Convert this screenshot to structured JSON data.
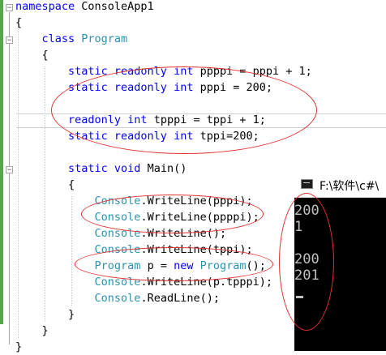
{
  "code": {
    "lines": [
      {
        "id": "l1",
        "parts": [
          {
            "t": "namespace",
            "c": "kw"
          },
          {
            "t": " ConsoleApp1",
            "c": ""
          }
        ]
      },
      {
        "id": "l2",
        "parts": [
          {
            "t": "{",
            "c": ""
          }
        ]
      },
      {
        "id": "l3",
        "parts": [
          {
            "t": "    class ",
            "c": "kw"
          },
          {
            "t": "Program",
            "c": "ty"
          }
        ]
      },
      {
        "id": "l4",
        "parts": [
          {
            "t": "    {",
            "c": ""
          }
        ]
      },
      {
        "id": "l5",
        "parts": [
          {
            "t": "        static readonly int",
            "c": "kw"
          },
          {
            "t": " ppppi = pppi + 1;",
            "c": ""
          }
        ]
      },
      {
        "id": "l6",
        "parts": [
          {
            "t": "        static readonly int",
            "c": "kw"
          },
          {
            "t": " pppi = 200;",
            "c": ""
          }
        ]
      },
      {
        "id": "l7",
        "parts": []
      },
      {
        "id": "l8",
        "parts": [
          {
            "t": "        readonly int",
            "c": "kw"
          },
          {
            "t": " tpppi = tppi + 1;",
            "c": ""
          }
        ]
      },
      {
        "id": "l9",
        "parts": [
          {
            "t": "        static readonly int",
            "c": "kw"
          },
          {
            "t": " tppi=200;",
            "c": ""
          }
        ]
      },
      {
        "id": "l10",
        "parts": []
      },
      {
        "id": "l11",
        "parts": [
          {
            "t": "        static void",
            "c": "kw"
          },
          {
            "t": " Main()",
            "c": ""
          }
        ]
      },
      {
        "id": "l12",
        "parts": [
          {
            "t": "        {",
            "c": ""
          }
        ]
      },
      {
        "id": "l13",
        "parts": [
          {
            "t": "            Console",
            "c": "ty"
          },
          {
            "t": ".WriteLine(pppi);",
            "c": ""
          }
        ]
      },
      {
        "id": "l14",
        "parts": [
          {
            "t": "            Console",
            "c": "ty"
          },
          {
            "t": ".WriteLine(ppppi);",
            "c": ""
          }
        ]
      },
      {
        "id": "l15",
        "parts": [
          {
            "t": "            Console",
            "c": "ty"
          },
          {
            "t": ".WriteLine();",
            "c": ""
          }
        ]
      },
      {
        "id": "l16",
        "parts": [
          {
            "t": "            Console",
            "c": "ty"
          },
          {
            "t": ".WriteLine(tppi);",
            "c": ""
          }
        ]
      },
      {
        "id": "l17",
        "parts": [
          {
            "t": "            Program",
            "c": "ty"
          },
          {
            "t": " p = ",
            "c": ""
          },
          {
            "t": "new",
            "c": "kw"
          },
          {
            "t": " ",
            "c": ""
          },
          {
            "t": "Program",
            "c": "ty"
          },
          {
            "t": "();",
            "c": ""
          }
        ]
      },
      {
        "id": "l18",
        "parts": [
          {
            "t": "            Console",
            "c": "ty"
          },
          {
            "t": ".WriteLine(p.tpppi);",
            "c": ""
          }
        ]
      },
      {
        "id": "l19",
        "parts": [
          {
            "t": "            Console",
            "c": "ty"
          },
          {
            "t": ".ReadLine();",
            "c": ""
          }
        ]
      },
      {
        "id": "l20",
        "parts": [
          {
            "t": "        }",
            "c": ""
          }
        ]
      },
      {
        "id": "l21",
        "parts": [
          {
            "t": "    }",
            "c": ""
          }
        ]
      },
      {
        "id": "l22",
        "parts": [
          {
            "t": "}",
            "c": ""
          }
        ]
      }
    ],
    "fold_symbol": "−"
  },
  "console": {
    "title": "F:\\软件\\c#\\",
    "output": [
      "200",
      "1",
      "",
      "200",
      "201"
    ]
  },
  "annotation_color": "#e0302f"
}
